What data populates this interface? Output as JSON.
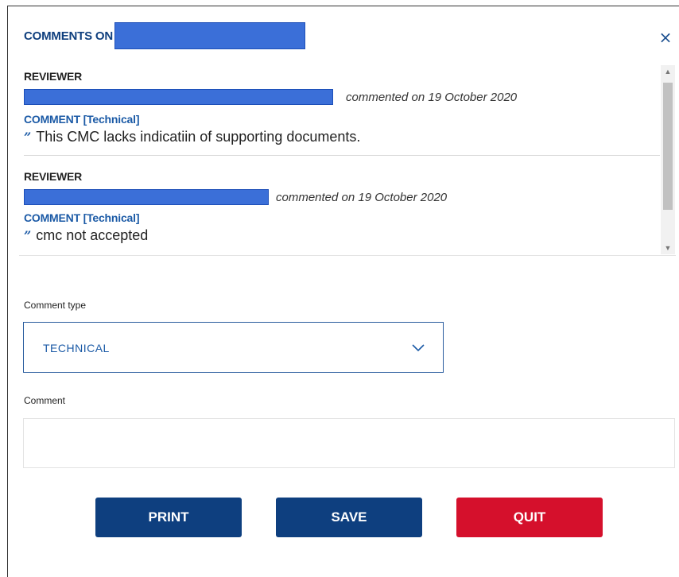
{
  "header": {
    "title": "COMMENTS ON",
    "close_icon": "×"
  },
  "comments": [
    {
      "reviewer_label": "REVIEWER",
      "commented_on": "commented on 19 October 2020",
      "comment_label": "COMMENT [Technical]",
      "quote_icon": "”",
      "text": "This CMC lacks indicatiin of supporting documents."
    },
    {
      "reviewer_label": "REVIEWER",
      "commented_on": "commented on 19 October 2020",
      "comment_label": "COMMENT [Technical]",
      "quote_icon": "”",
      "text": "cmc not accepted"
    }
  ],
  "scrollbar": {
    "up_icon": "▲",
    "down_icon": "▼"
  },
  "form": {
    "comment_type_label": "Comment type",
    "comment_type_value": "TECHNICAL",
    "comment_label": "Comment",
    "comment_value": ""
  },
  "buttons": {
    "print": "PRINT",
    "save": "SAVE",
    "quit": "QUIT"
  },
  "colors": {
    "primary": "#0e3f7f",
    "danger": "#d5102c",
    "link_blue": "#1b5aa6",
    "redaction": "#3b6fd8"
  },
  "icons": {
    "close": "close-icon",
    "quote": "quote-icon",
    "dropdown": "chevron-down-icon"
  }
}
